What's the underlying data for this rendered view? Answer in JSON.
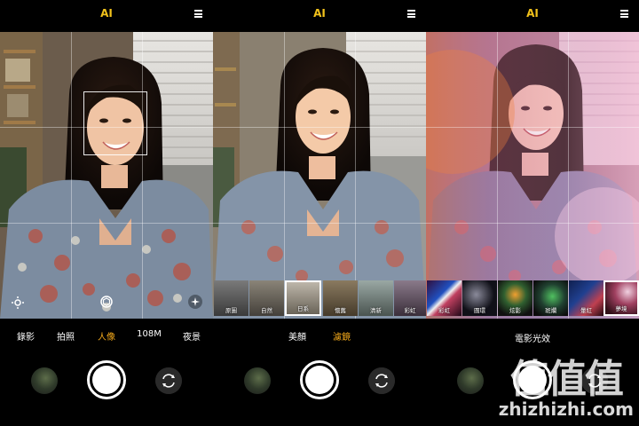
{
  "panels": [
    {
      "ai_label": "AI",
      "modes": [
        "錄影",
        "拍照",
        "人像",
        "108M",
        "夜景"
      ],
      "active_mode": "人像"
    },
    {
      "ai_label": "AI",
      "tabs": [
        "美顏",
        "濾鏡"
      ],
      "active_tab": "濾鏡",
      "filters": [
        {
          "label": "原圖"
        },
        {
          "label": "自然"
        },
        {
          "label": "日系"
        },
        {
          "label": "懷舊"
        },
        {
          "label": "清新"
        },
        {
          "label": "彩虹"
        }
      ],
      "selected_filter": "日系"
    },
    {
      "ai_label": "AI",
      "caption": "電影光效",
      "effects": [
        {
          "label": "彩虹"
        },
        {
          "label": "圓環"
        },
        {
          "label": "炫影"
        },
        {
          "label": "斑斕"
        },
        {
          "label": "暈紅"
        },
        {
          "label": "夢境"
        }
      ],
      "selected_effect": "夢境"
    }
  ],
  "watermark": {
    "title": "值值值",
    "subtitle": "zhizhizhi.com"
  },
  "colors": {
    "accent_yellow": "#f2c21b",
    "active_orange": "#f2a81b"
  },
  "icons": [
    "menu-icon",
    "settings-icon",
    "aperture-icon",
    "ai-sparkle-icon",
    "switch-camera-icon"
  ]
}
